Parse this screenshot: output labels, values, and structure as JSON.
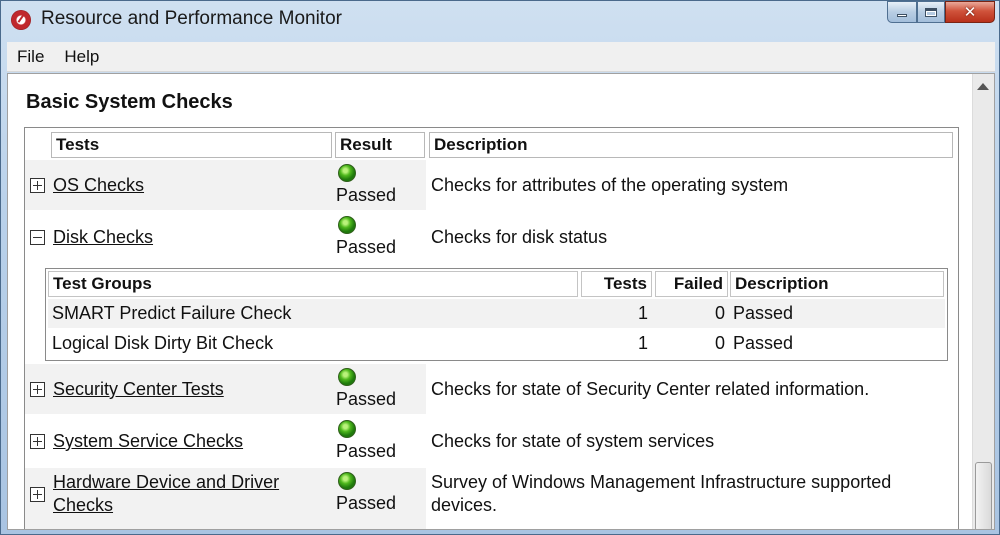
{
  "window": {
    "title": "Resource and Performance Monitor"
  },
  "menu": [
    "File",
    "Help"
  ],
  "section_title": "Basic System Checks",
  "columns": {
    "tests": "Tests",
    "result": "Result",
    "description": "Description"
  },
  "checks": [
    {
      "name": "OS Checks",
      "expanded": false,
      "result": "Passed",
      "description": "Checks for attributes of the operating system"
    },
    {
      "name": "Disk Checks",
      "expanded": true,
      "result": "Passed",
      "description": "Checks for disk status"
    },
    {
      "name": "Security Center Tests",
      "expanded": false,
      "result": "Passed",
      "description": "Checks for state of Security Center related information."
    },
    {
      "name": "System Service Checks",
      "expanded": false,
      "result": "Passed",
      "description": "Checks for state of system services"
    },
    {
      "name_line1": "Hardware Device and Driver",
      "name_line2": "Checks",
      "expanded": false,
      "result": "Passed",
      "description_line1": "Survey of Windows Management Infrastructure supported",
      "description_line2": "devices."
    }
  ],
  "disk_groups": {
    "columns": {
      "group": "Test Groups",
      "tests": "Tests",
      "failed": "Failed",
      "description": "Description"
    },
    "rows": [
      {
        "group": "SMART Predict Failure Check",
        "tests": "1",
        "failed": "0",
        "description": "Passed"
      },
      {
        "group": "Logical Disk Dirty Bit Check",
        "tests": "1",
        "failed": "0",
        "description": "Passed"
      }
    ]
  },
  "icons": {
    "app": "resource-monitor-icon",
    "status": "green-status-icon"
  },
  "colors": {
    "status_green": "#4fb81d",
    "close_red": "#c8442c"
  }
}
